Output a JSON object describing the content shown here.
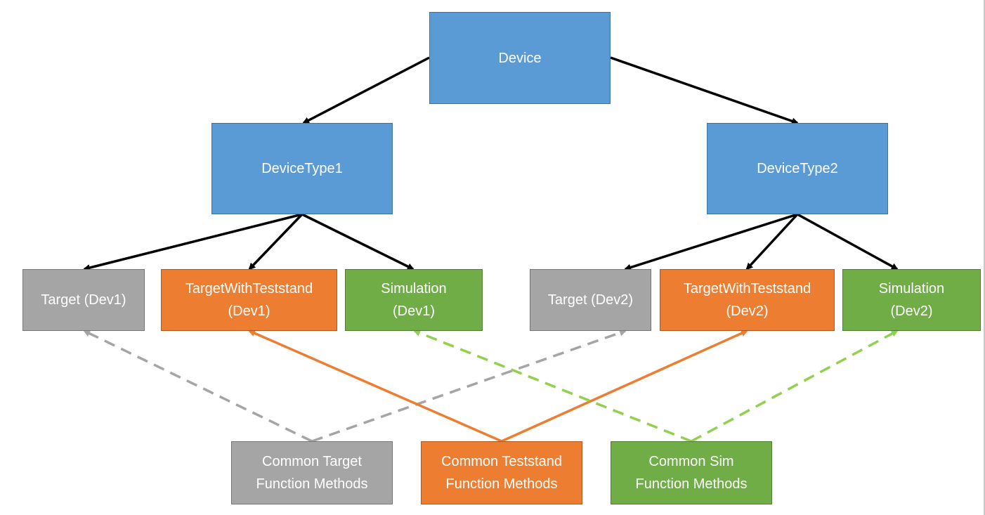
{
  "colors": {
    "blue": "#5B9BD5",
    "orange": "#ED7D31",
    "green": "#70AD47",
    "gray": "#A5A5A5",
    "dashed_green": "#92D050",
    "dashed_gray": "#A5A5A5",
    "arrow_black": "#000000"
  },
  "nodes": {
    "device": {
      "label": "Device",
      "color": "blue"
    },
    "devicetype1": {
      "label": "DeviceType1",
      "color": "blue"
    },
    "devicetype2": {
      "label": "DeviceType2",
      "color": "blue"
    },
    "target_dev1": {
      "label": "Target (Dev1)",
      "color": "gray"
    },
    "teststand_dev1": {
      "label": "TargetWithTeststand\n(Dev1)",
      "color": "orange"
    },
    "simulation_dev1": {
      "label": "Simulation\n(Dev1)",
      "color": "green"
    },
    "target_dev2": {
      "label": "Target (Dev2)",
      "color": "gray"
    },
    "teststand_dev2": {
      "label": "TargetWithTeststand\n(Dev2)",
      "color": "orange"
    },
    "simulation_dev2": {
      "label": "Simulation\n(Dev2)",
      "color": "green"
    },
    "common_target": {
      "label": "Common Target\nFunction Methods",
      "color": "gray"
    },
    "common_teststand": {
      "label": "Common Teststand\nFunction Methods",
      "color": "orange"
    },
    "common_sim": {
      "label": "Common Sim\nFunction Methods",
      "color": "green"
    }
  },
  "edges": [
    {
      "from": "device",
      "to": "devicetype1",
      "style": "solid",
      "color": "arrow_black"
    },
    {
      "from": "device",
      "to": "devicetype2",
      "style": "solid",
      "color": "arrow_black"
    },
    {
      "from": "devicetype1",
      "to": "target_dev1",
      "style": "solid",
      "color": "arrow_black"
    },
    {
      "from": "devicetype1",
      "to": "teststand_dev1",
      "style": "solid",
      "color": "arrow_black"
    },
    {
      "from": "devicetype1",
      "to": "simulation_dev1",
      "style": "solid",
      "color": "arrow_black"
    },
    {
      "from": "devicetype2",
      "to": "target_dev2",
      "style": "solid",
      "color": "arrow_black"
    },
    {
      "from": "devicetype2",
      "to": "teststand_dev2",
      "style": "solid",
      "color": "arrow_black"
    },
    {
      "from": "devicetype2",
      "to": "simulation_dev2",
      "style": "solid",
      "color": "arrow_black"
    },
    {
      "from": "common_target",
      "to": "target_dev1",
      "style": "dashed",
      "color": "dashed_gray"
    },
    {
      "from": "common_target",
      "to": "target_dev2",
      "style": "dashed",
      "color": "dashed_gray"
    },
    {
      "from": "common_teststand",
      "to": "teststand_dev1",
      "style": "solid",
      "color": "orange"
    },
    {
      "from": "common_teststand",
      "to": "teststand_dev2",
      "style": "solid",
      "color": "orange"
    },
    {
      "from": "common_sim",
      "to": "simulation_dev1",
      "style": "dashed",
      "color": "dashed_green"
    },
    {
      "from": "common_sim",
      "to": "simulation_dev2",
      "style": "dashed",
      "color": "dashed_green"
    }
  ]
}
